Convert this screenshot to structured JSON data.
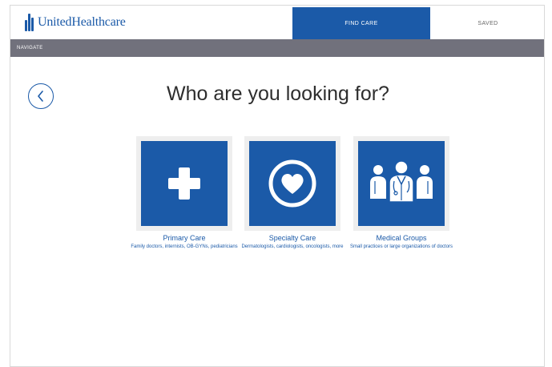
{
  "header": {
    "brand": "UnitedHealthcare",
    "tabs": [
      {
        "label": "FIND CARE",
        "active": true
      },
      {
        "label": "SAVED",
        "active": false
      }
    ]
  },
  "subnav": {
    "label": "NAVIGATE"
  },
  "page": {
    "title": "Who are you looking for?"
  },
  "options": [
    {
      "title": "Primary Care",
      "description": "Family doctors, internists, OB-GYNs, pediatricians",
      "icon": "plus-icon"
    },
    {
      "title": "Specialty Care",
      "description": "Dermatologists, cardiologists, oncologists, more",
      "icon": "heart-icon"
    },
    {
      "title": "Medical Groups",
      "description": "Small practices or large organizations of doctors",
      "icon": "doctors-group-icon"
    }
  ],
  "colors": {
    "brand_blue": "#1b5aa8",
    "nav_gray": "#71717c",
    "card_bg": "#eeeeee"
  }
}
